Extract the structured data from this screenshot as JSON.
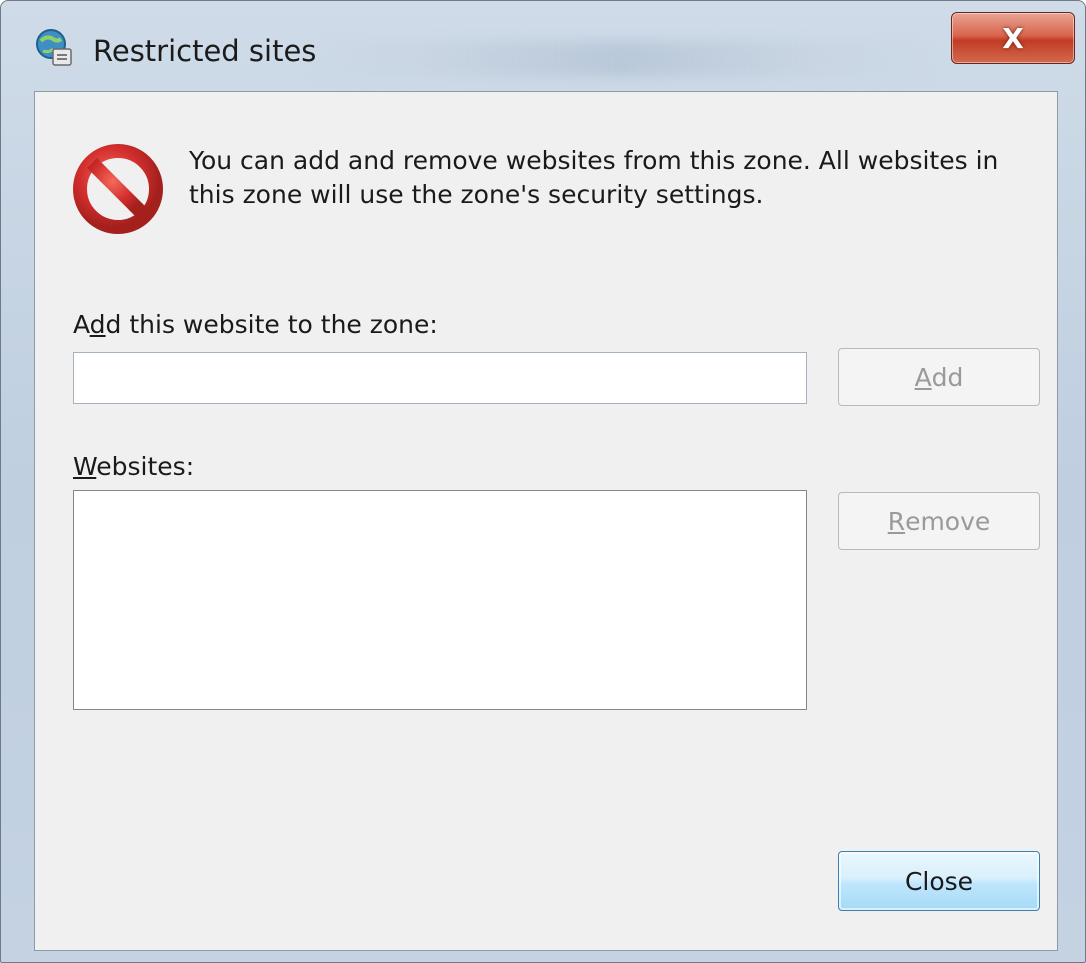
{
  "window": {
    "title": "Restricted sites",
    "close_glyph": "X",
    "app_icon": "globe-lock-icon"
  },
  "info": {
    "icon": "no-entry-icon",
    "text": "You can add and remove websites from this zone. All websites in this zone will use the zone's security settings."
  },
  "add_section": {
    "label_pre": "A",
    "label_mnemonic": "d",
    "label_post": "d this website to the zone:",
    "input_value": "",
    "input_placeholder": "",
    "button_pre": "",
    "button_mnemonic": "A",
    "button_post": "dd",
    "button_enabled": false
  },
  "websites_section": {
    "label_mnemonic": "W",
    "label_post": "ebsites:",
    "items": [],
    "remove_pre": "",
    "remove_mnemonic": "R",
    "remove_post": "emove",
    "remove_enabled": false
  },
  "footer": {
    "close_label": "Close"
  },
  "colors": {
    "client_bg": "#f0f0f0",
    "close_x_red": "#c23b24",
    "no_entry_red": "#d32f2f",
    "default_button_blue": "#3c7fb1"
  }
}
